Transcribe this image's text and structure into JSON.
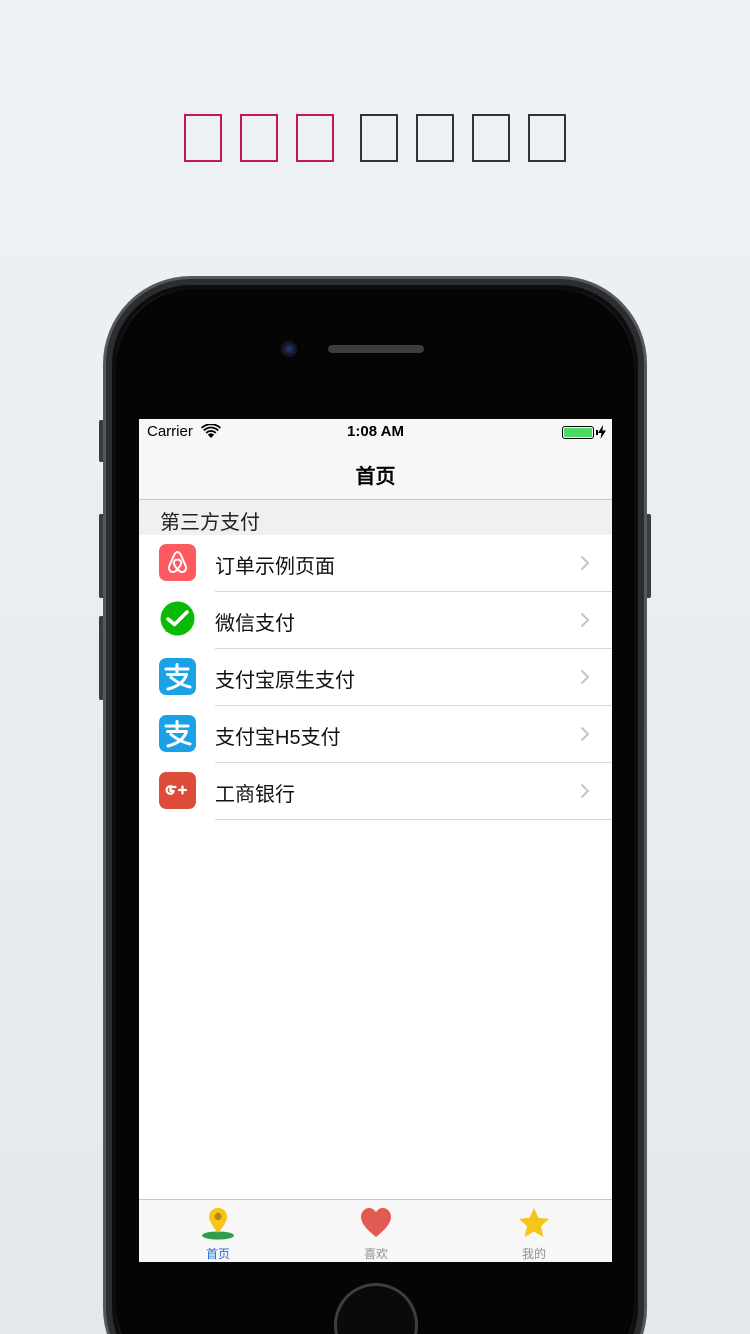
{
  "status_bar": {
    "carrier": "Carrier",
    "time": "1:08 AM",
    "battery_color": "#4cd964"
  },
  "nav": {
    "title": "首页"
  },
  "section": {
    "title": "第三方支付"
  },
  "rows": [
    {
      "label": "订单示例页面",
      "icon": "airbnb-icon",
      "color": "#ff5a5f"
    },
    {
      "label": "微信支付",
      "icon": "wechat-icon",
      "color": "#09bb07"
    },
    {
      "label": "支付宝原生支付",
      "icon": "alipay-icon",
      "color": "#1ba1e6"
    },
    {
      "label": "支付宝H5支付",
      "icon": "alipay-icon",
      "color": "#1ba1e6"
    },
    {
      "label": "工商银行",
      "icon": "google-plus-icon",
      "color": "#dd4b39"
    }
  ],
  "tabs": [
    {
      "label": "首页",
      "icon": "location-pin-icon",
      "active": true
    },
    {
      "label": "喜欢",
      "icon": "heart-icon",
      "active": false
    },
    {
      "label": "我的",
      "icon": "star-icon",
      "active": false
    }
  ],
  "colors": {
    "accent": "#1e6fd9",
    "title_box_highlight": "#c2185b"
  }
}
